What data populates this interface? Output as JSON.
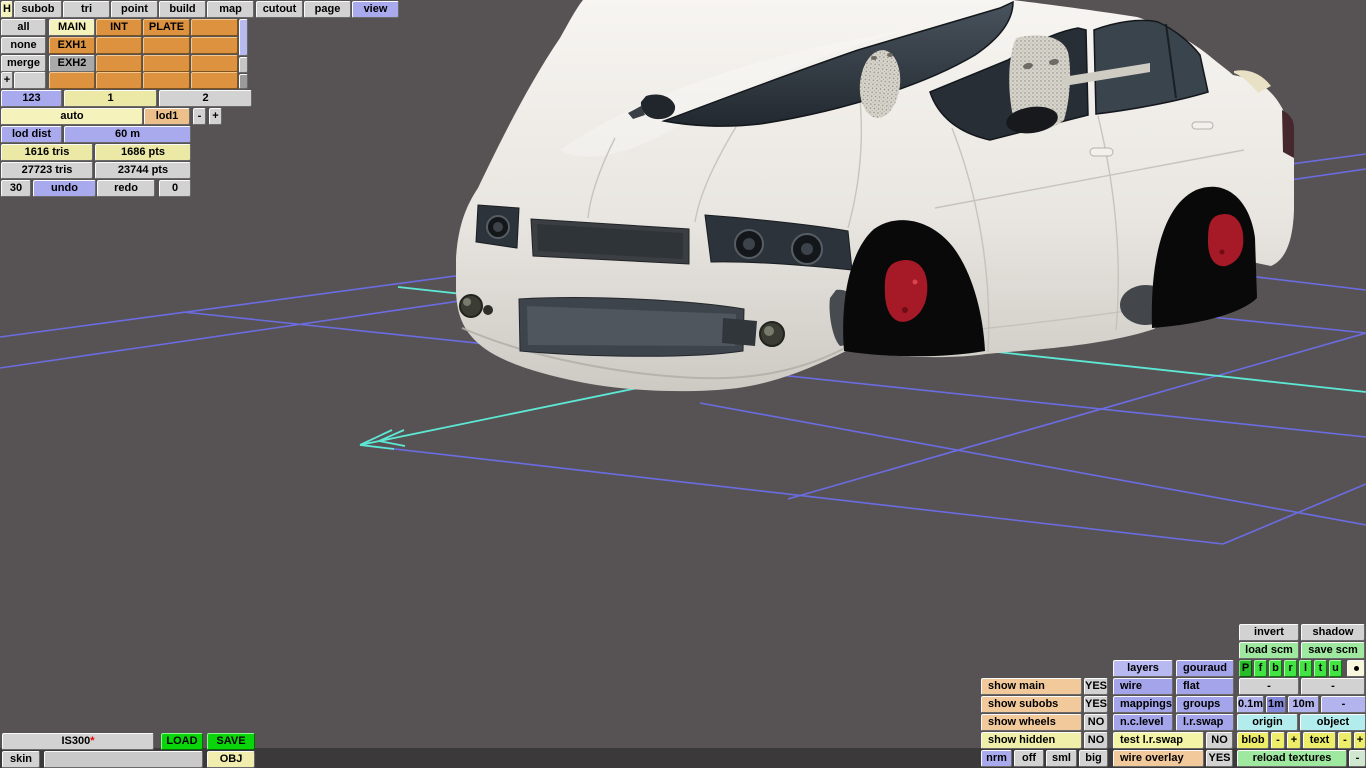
{
  "menu": {
    "items": [
      "H",
      "subob",
      "tri",
      "point",
      "build",
      "map",
      "cutout",
      "page",
      "view"
    ],
    "active_item": "view"
  },
  "subobj_panel": {
    "actions": [
      "all",
      "none",
      "merge",
      "+"
    ],
    "cells": [
      [
        "MAIN",
        "INT",
        "PLATE",
        ""
      ],
      [
        "EXH1",
        "",
        "",
        ""
      ],
      [
        "EXH2",
        "",
        "",
        ""
      ],
      [
        "",
        "",
        "",
        ""
      ]
    ]
  },
  "page_tabs": {
    "tabs": [
      "123",
      "1",
      "2"
    ],
    "active": "1"
  },
  "lod": {
    "auto_label": "auto",
    "current": "lod1",
    "dec": "-",
    "inc": "+",
    "dist_label": "lod dist",
    "dist_value": "60 m"
  },
  "stats": {
    "selected_tris": "1616 tris",
    "selected_pts": "1686 pts",
    "total_tris": "27723 tris",
    "total_pts": "23744 pts",
    "undo_steps": "30",
    "undo_label": "undo",
    "redo_label": "redo",
    "redo_steps": "0"
  },
  "file_bar": {
    "model_name": "IS300",
    "modified_flag": "*",
    "load_label": "LOAD",
    "save_label": "SAVE",
    "skin_label": "skin",
    "skin_value": "",
    "obj_label": "OBJ"
  },
  "display_panel": {
    "invert_label": "invert",
    "shadow_label": "shadow",
    "load_scm_label": "load scm",
    "save_scm_label": "save scm",
    "layers_label": "layers",
    "gouraud_label": "gouraud",
    "channels": [
      "P",
      "f",
      "b",
      "r",
      "l",
      "t",
      "u"
    ],
    "channel_dot": "•",
    "show_main_label": "show main",
    "show_main_value": "YES",
    "show_subobs_label": "show subobs",
    "show_subobs_value": "YES",
    "show_wheels_label": "show wheels",
    "show_wheels_value": "NO",
    "show_hidden_label": "show hidden",
    "show_hidden_value": "NO",
    "wire_label": "wire",
    "flat_label": "flat",
    "flat_dash_1": "-",
    "flat_dash_2": "-",
    "mappings_label": "mappings",
    "groups_label": "groups",
    "grid_steps": [
      "0.1m",
      "1m",
      "10m",
      "-"
    ],
    "grid_step_active": "1m",
    "nc_level_label": "n.c.level",
    "lr_swap_label": "l.r.swap",
    "origin_label": "origin",
    "object_label": "object",
    "test_lr_swap_label": "test l.r.swap",
    "test_lr_swap_value": "NO",
    "blob_label": "blob",
    "blob_dec": "-",
    "blob_inc": "+",
    "text_label": "text",
    "text_dec": "-",
    "text_inc": "+",
    "nrm_label": "nrm",
    "nrm_off": "off",
    "nrm_sml": "sml",
    "nrm_big": "big",
    "wire_overlay_label": "wire overlay",
    "wire_overlay_value": "YES",
    "reload_textures_label": "reload textures",
    "reload_dash": "-"
  },
  "viewport_colors": {
    "background": "#575354",
    "grid": "#6b6ce2",
    "axis": "#5de8d5",
    "body": "#efede8",
    "caliper": "#a51a26"
  }
}
